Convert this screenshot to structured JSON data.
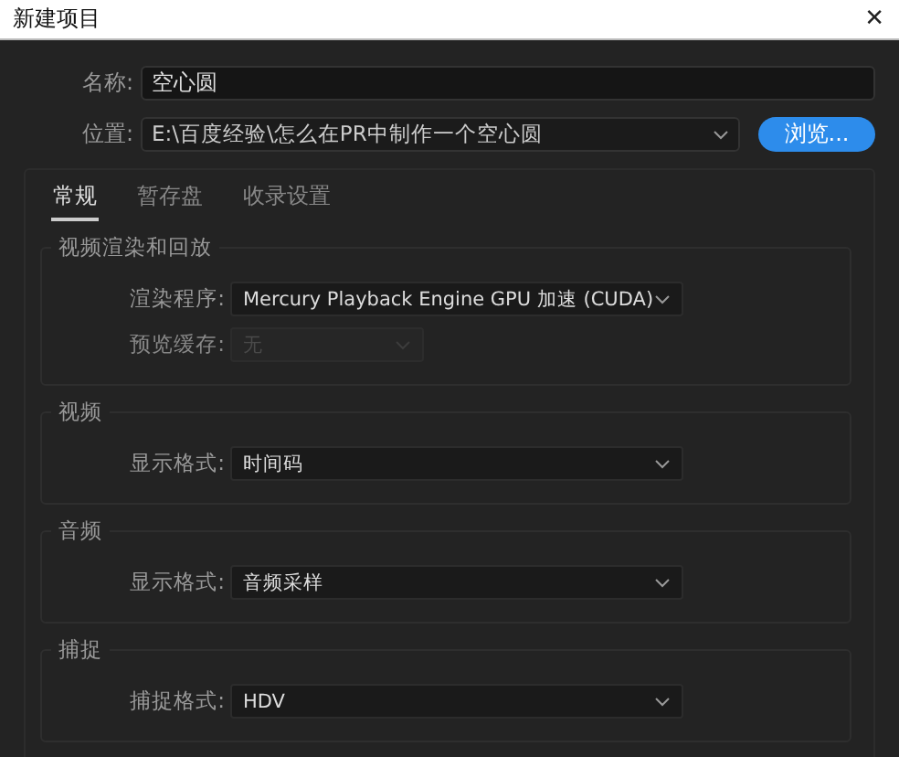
{
  "window": {
    "title": "新建项目",
    "close": "✕"
  },
  "name_field": {
    "label": "名称:",
    "value": "空心圆"
  },
  "location_field": {
    "label": "位置:",
    "value": "E:\\百度经验\\怎么在PR中制作一个空心圆"
  },
  "browse_button": "浏览...",
  "tabs": [
    {
      "label": "常规",
      "selected": true
    },
    {
      "label": "暂存盘",
      "selected": false
    },
    {
      "label": "收录设置",
      "selected": false
    }
  ],
  "groups": [
    {
      "title": "视频渲染和回放",
      "rows": [
        {
          "label": "渲染程序:",
          "value": "Mercury Playback Engine GPU 加速 (CUDA)",
          "disabled": false
        },
        {
          "label": "预览缓存:",
          "value": "无",
          "disabled": true
        }
      ]
    },
    {
      "title": "视频",
      "rows": [
        {
          "label": "显示格式:",
          "value": "时间码",
          "disabled": false
        }
      ]
    },
    {
      "title": "音频",
      "rows": [
        {
          "label": "显示格式:",
          "value": "音频采样",
          "disabled": false
        }
      ]
    },
    {
      "title": "捕捉",
      "rows": [
        {
          "label": "捕捉格式:",
          "value": "HDV",
          "disabled": false
        }
      ]
    }
  ]
}
